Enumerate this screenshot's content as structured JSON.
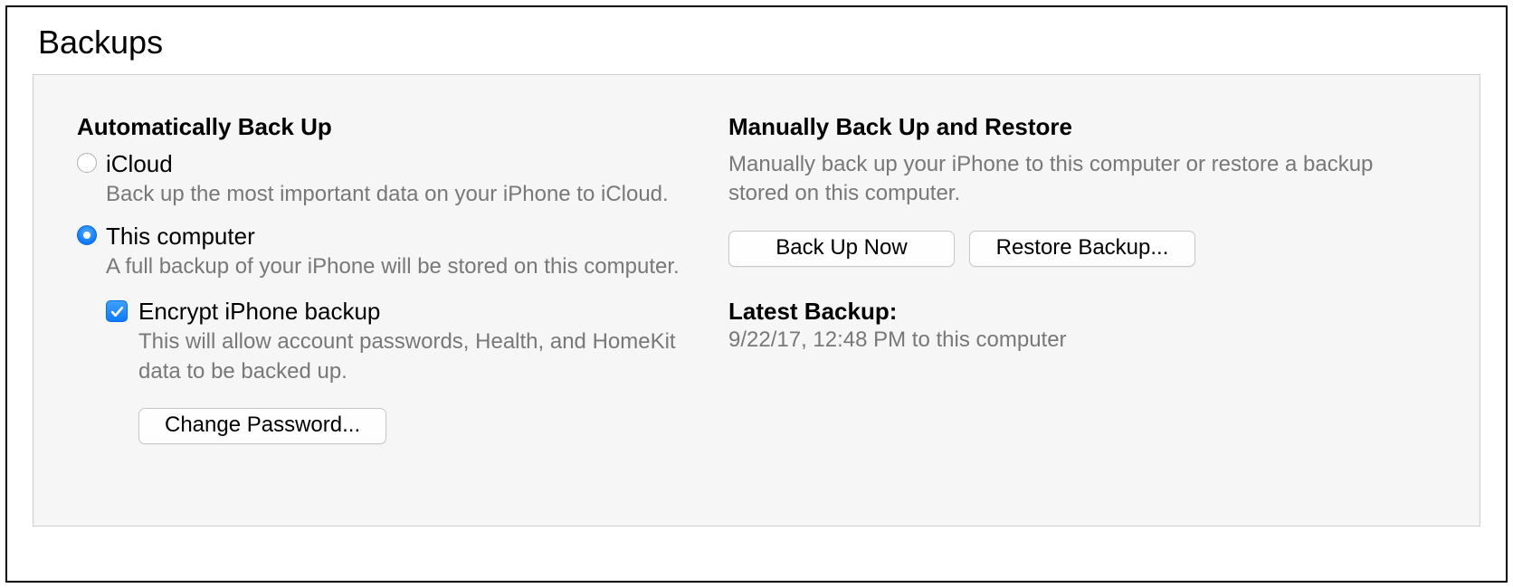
{
  "section_title": "Backups",
  "auto": {
    "heading": "Automatically Back Up",
    "icloud": {
      "label": "iCloud",
      "desc": "Back up the most important data on your iPhone to iCloud.",
      "selected": false
    },
    "this_computer": {
      "label": "This computer",
      "desc": "A full backup of your iPhone will be stored on this computer.",
      "selected": true
    },
    "encrypt": {
      "label": "Encrypt iPhone backup",
      "desc": "This will allow account passwords, Health, and HomeKit data to be backed up.",
      "checked": true
    },
    "change_password_label": "Change Password..."
  },
  "manual": {
    "heading": "Manually Back Up and Restore",
    "desc": "Manually back up your iPhone to this computer or restore a backup stored on this computer.",
    "backup_now_label": "Back Up Now",
    "restore_label": "Restore Backup..."
  },
  "latest": {
    "heading": "Latest Backup:",
    "value": "9/22/17, 12:48 PM to this computer"
  }
}
